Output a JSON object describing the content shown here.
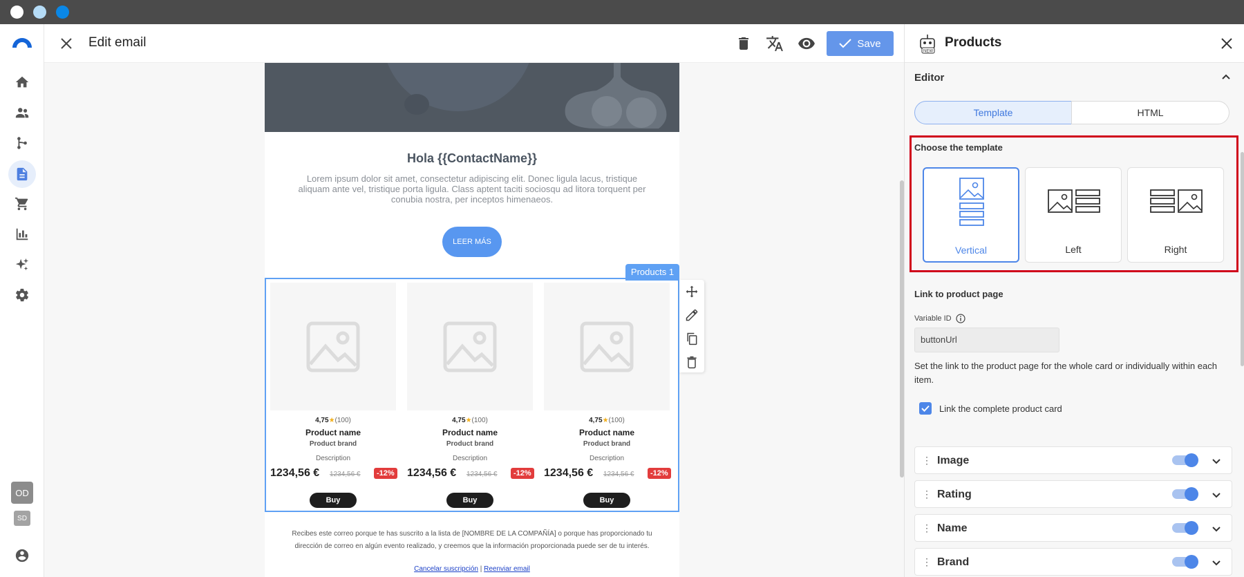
{
  "window": {
    "dots": [
      "#ffffff",
      "#b5dcf7",
      "#0a87e6"
    ]
  },
  "nav": {
    "items": [
      "home-icon",
      "contacts-icon",
      "flows-icon",
      "templates-icon",
      "cart-icon",
      "reports-icon",
      "ai-icon",
      "settings-icon"
    ],
    "active": "templates-icon",
    "badge_od": "OD",
    "badge_sd": "SD"
  },
  "header": {
    "title": "Edit email",
    "save_label": "Save"
  },
  "email": {
    "greeting": "Hola {{ContactName}}",
    "body": "Lorem ipsum dolor sit amet, consectetur adipiscing elit. Donec ligula lacus, tristique aliquam ante vel, tristique porta ligula. Class aptent taciti sociosqu ad litora torquent per conubia nostra, per inceptos himenaeos.",
    "cta": "LEER MÁS",
    "block_tag": "Products 1",
    "products": [
      {
        "rating": "4,75",
        "reviews": "(100)",
        "name": "Product name",
        "brand": "Product brand",
        "description": "Description",
        "price": "1234,56 €",
        "old_price": "1234,56 €",
        "discount": "-12%",
        "buy": "Buy"
      },
      {
        "rating": "4,75",
        "reviews": "(100)",
        "name": "Product name",
        "brand": "Product brand",
        "description": "Description",
        "price": "1234,56 €",
        "old_price": "1234,56 €",
        "discount": "-12%",
        "buy": "Buy"
      },
      {
        "rating": "4,75",
        "reviews": "(100)",
        "name": "Product name",
        "brand": "Product brand",
        "description": "Description",
        "price": "1234,56 €",
        "old_price": "1234,56 €",
        "discount": "-12%",
        "buy": "Buy"
      }
    ],
    "footer": "Recibes este correo porque te has suscrito a la lista de [NOMBRE DE LA COMPAÑÍA] o porque has proporcionado tu dirección de correo en algún evento realizado, y creemos que la información proporcionada puede ser de tu interés.",
    "unsubscribe": "Cancelar suscripción",
    "separator": "|",
    "forward": "Reenviar email"
  },
  "panel": {
    "title": "Products",
    "editor_label": "Editor",
    "tabs": [
      "Template",
      "HTML"
    ],
    "choose_label": "Choose the template",
    "templates": [
      "Vertical",
      "Left",
      "Right"
    ],
    "selected_template": "Vertical",
    "link_heading": "Link to product page",
    "variable_label": "Variable ID",
    "variable_value": "buttonUrl",
    "help": "Set the link to the product page for the whole card or individually within each item.",
    "checkbox_label": "Link the complete product card",
    "sections": [
      "Image",
      "Rating",
      "Name",
      "Brand"
    ],
    "accent": "#4d86e8",
    "highlight": "#d0021b"
  }
}
